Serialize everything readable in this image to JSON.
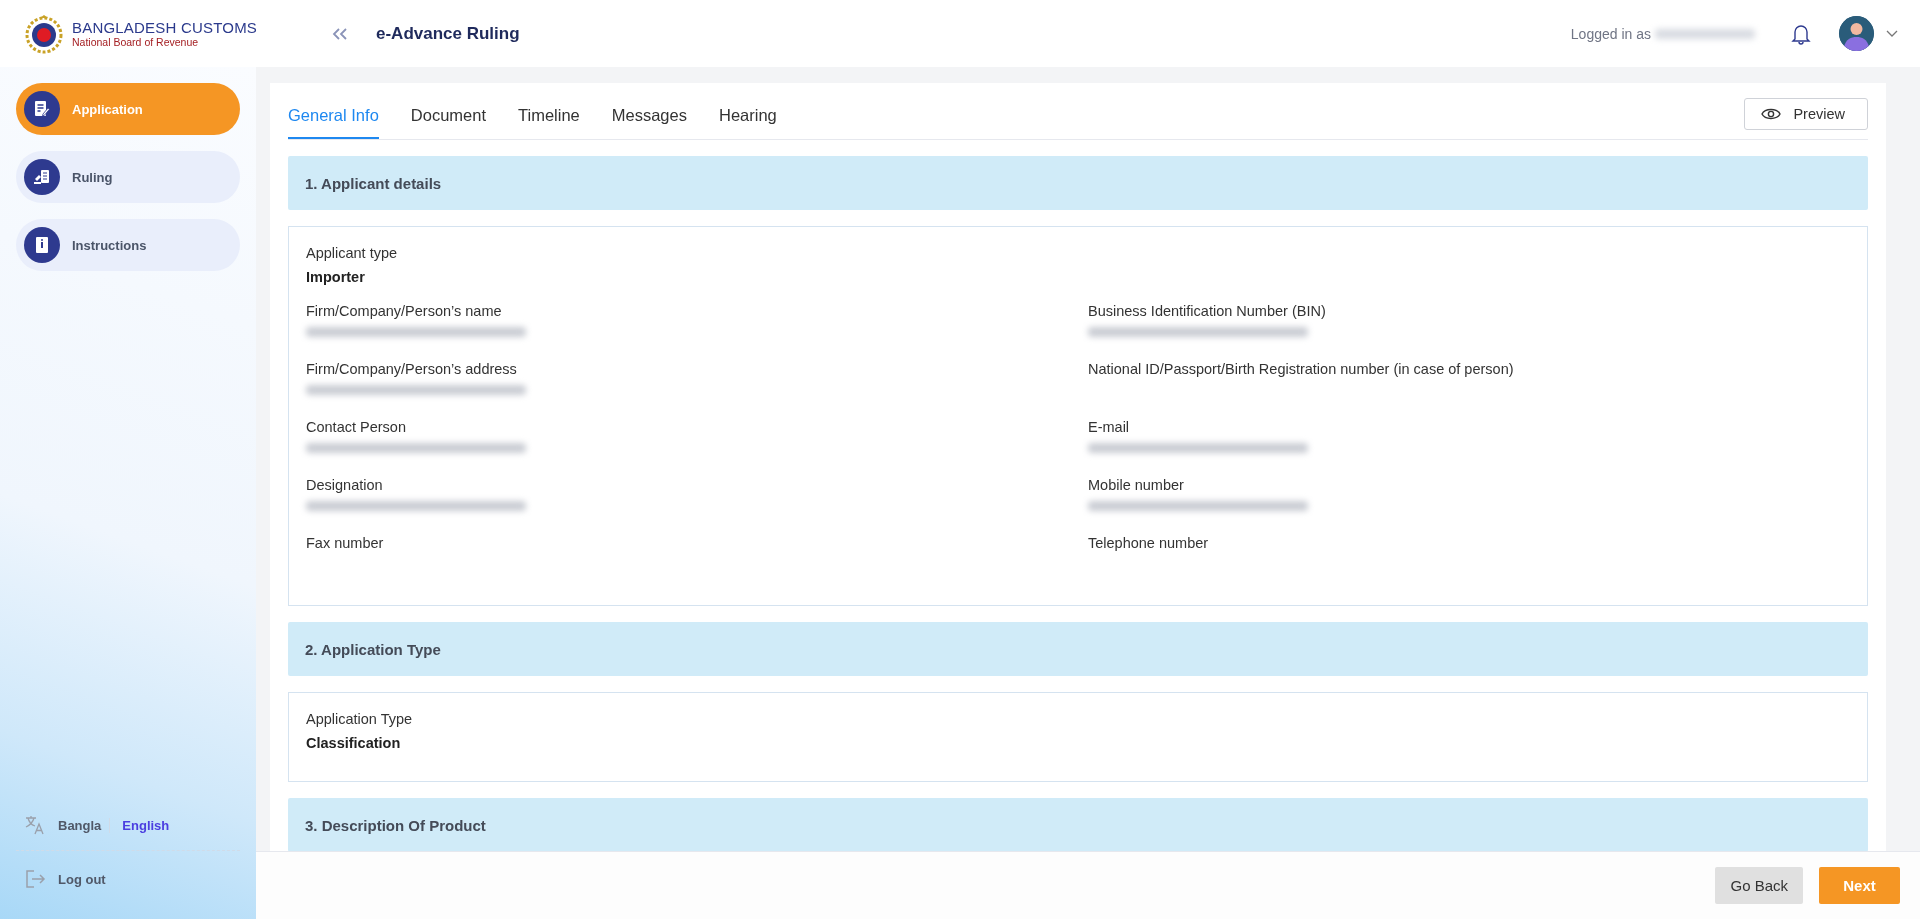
{
  "brand": {
    "title": "BANGLADESH CUSTOMS",
    "subtitle": "National Board of Revenue"
  },
  "header": {
    "title": "e-Advance Ruling",
    "logged_in_label": "Logged in as",
    "user_redacted": true
  },
  "sidebar": {
    "items": [
      {
        "label": "Application",
        "selected": true,
        "kind": "form"
      },
      {
        "label": "Ruling",
        "selected": false,
        "kind": "gavel"
      },
      {
        "label": "Instructions",
        "selected": false,
        "kind": "book"
      }
    ],
    "languages": [
      {
        "label": "Bangla",
        "selected": false
      },
      {
        "label": "English",
        "selected": true
      }
    ],
    "logout": "Log out"
  },
  "tabs": [
    {
      "label": "General Info",
      "selected": true
    },
    {
      "label": "Document",
      "selected": false
    },
    {
      "label": "Timeline",
      "selected": false
    },
    {
      "label": "Messages",
      "selected": false
    },
    {
      "label": "Hearing",
      "selected": false
    }
  ],
  "preview_button": "Preview",
  "sections": [
    {
      "title": "1. Applicant details",
      "top_fields": [
        {
          "label": "Applicant type",
          "value": "Importer"
        }
      ],
      "left_fields": [
        {
          "label": "Firm/Company/Person’s name",
          "redacted": true
        },
        {
          "label": "Firm/Company/Person’s address",
          "redacted": true
        },
        {
          "label": "Contact Person",
          "redacted": true
        },
        {
          "label": "Designation",
          "redacted": true
        },
        {
          "label": "Fax number"
        }
      ],
      "right_fields": [
        {
          "label": "Business Identification Number (BIN)",
          "redacted": true
        },
        {
          "label": "National ID/Passport/Birth Registration number (in case of person)"
        },
        {
          "label": "E-mail",
          "redacted": true
        },
        {
          "label": "Mobile number",
          "redacted": true
        },
        {
          "label": "Telephone number"
        }
      ]
    },
    {
      "title": "2. Application Type",
      "top_fields": [
        {
          "label": "Application Type",
          "value": "Classification"
        }
      ]
    },
    {
      "title": "3. Description Of Product"
    }
  ],
  "footer_buttons": [
    {
      "label": "Go Back",
      "kind": "secondary"
    },
    {
      "label": "Next",
      "kind": "primary"
    }
  ]
}
